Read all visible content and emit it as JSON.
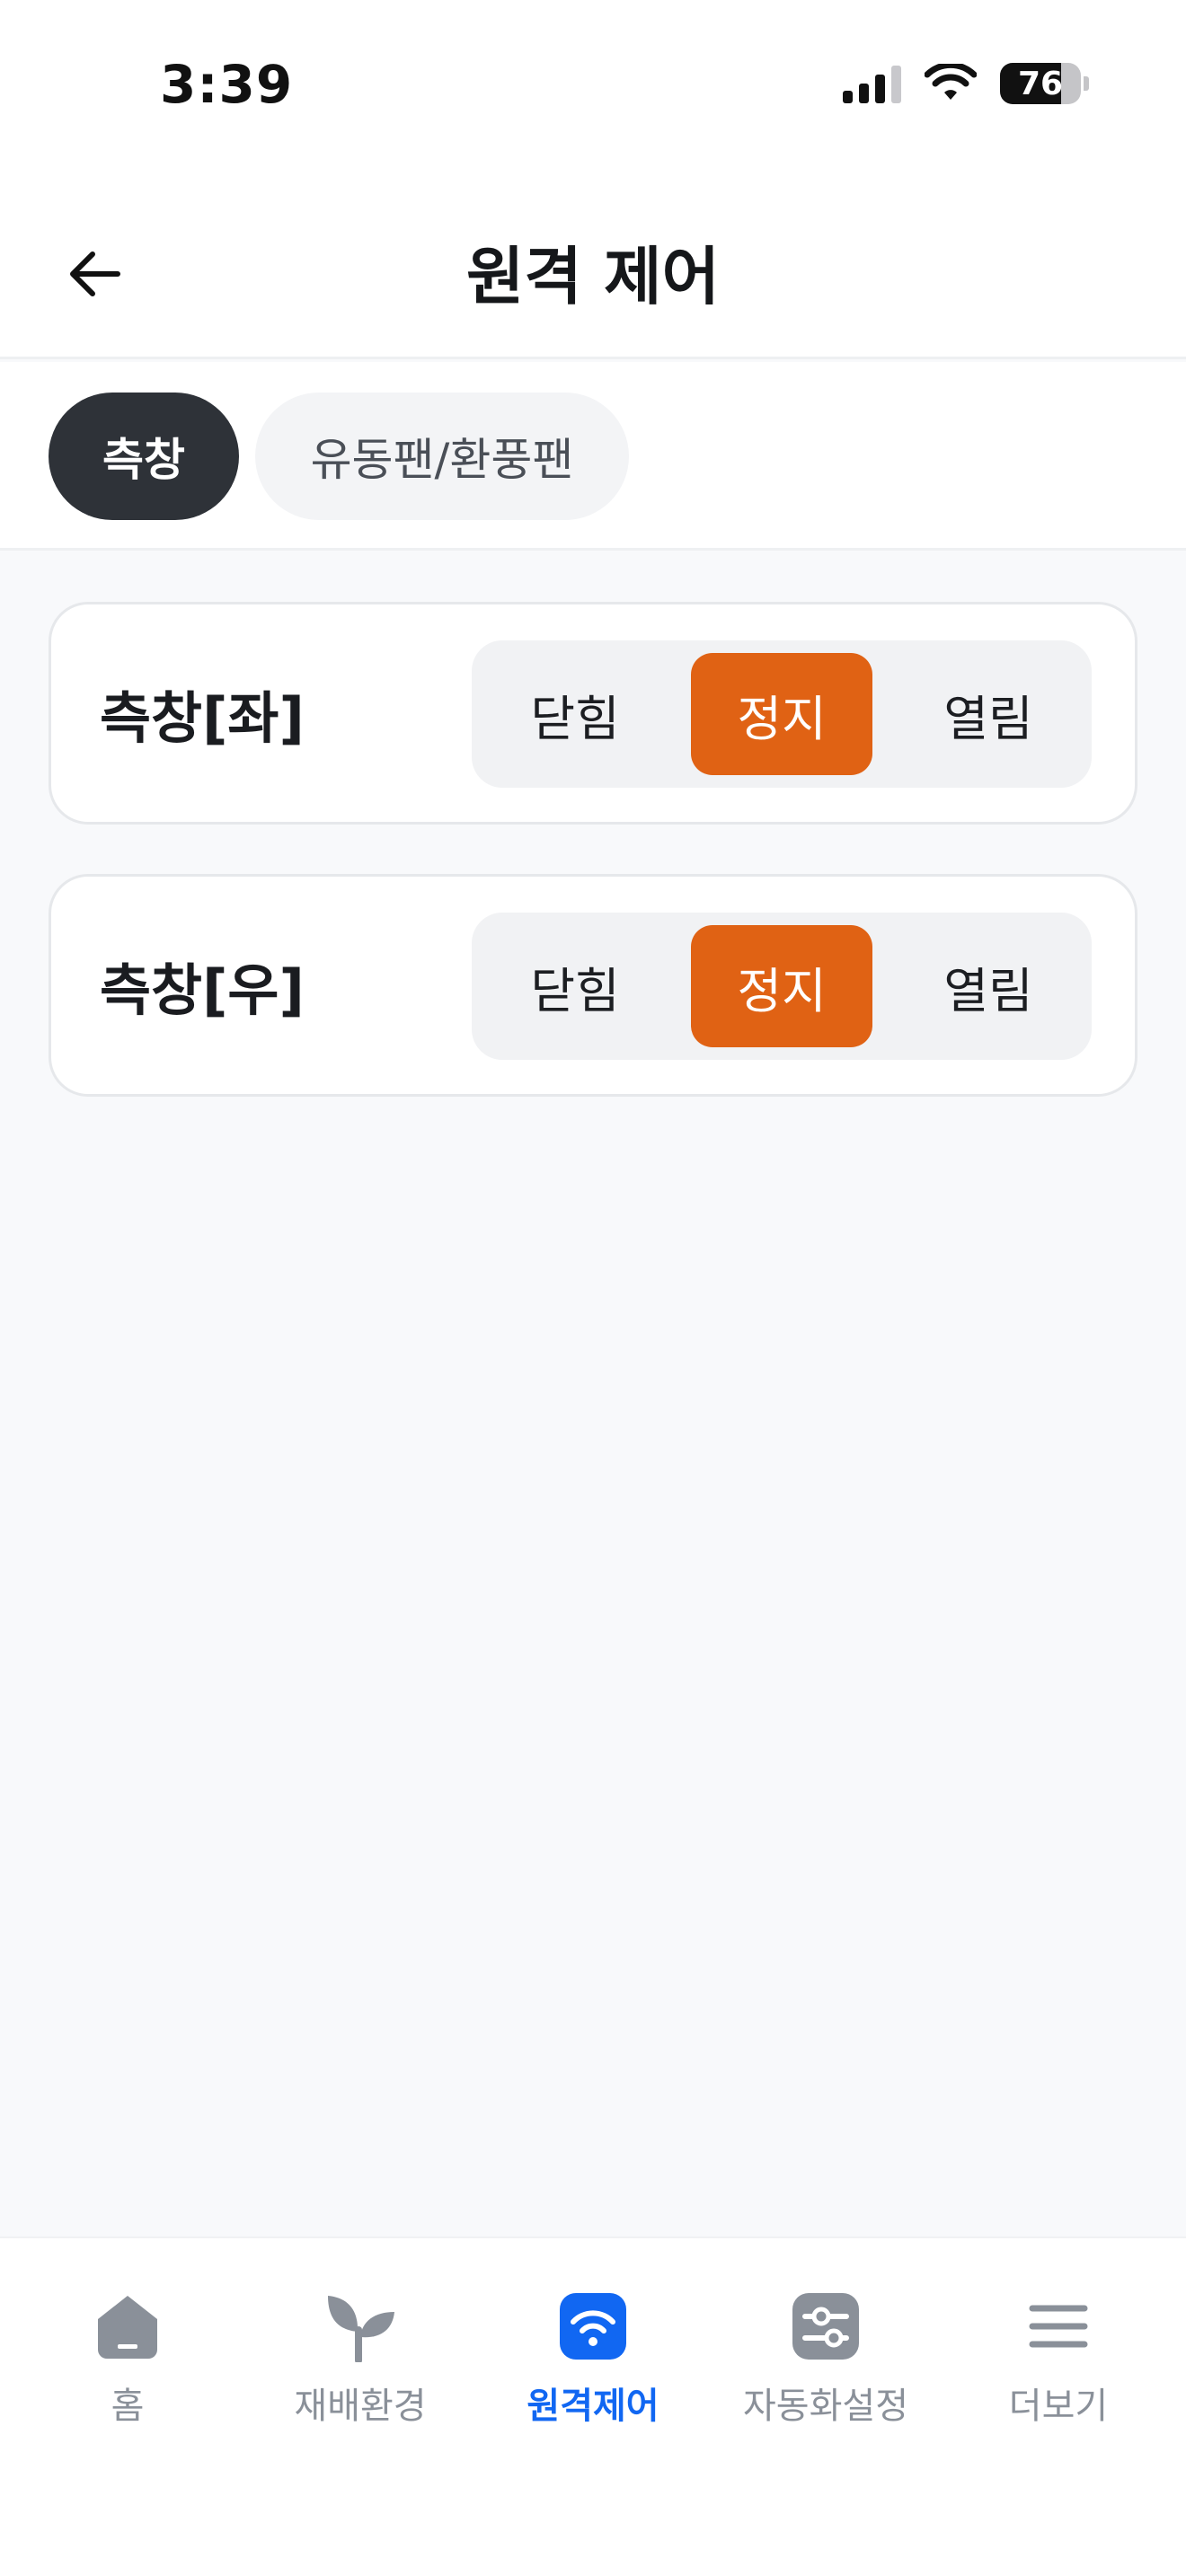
{
  "status_bar": {
    "time": "3:39",
    "battery": "76",
    "battery_level": 0.76
  },
  "header": {
    "title": "원격 제어",
    "back_icon": "arrow-left-icon"
  },
  "tabs": [
    {
      "label": "측창",
      "active": true
    },
    {
      "label": "유동팬/환풍팬",
      "active": false
    }
  ],
  "controls": [
    {
      "label": "측창[좌]",
      "options": [
        "닫힘",
        "정지",
        "열림"
      ],
      "selected": "정지"
    },
    {
      "label": "측창[우]",
      "options": [
        "닫힘",
        "정지",
        "열림"
      ],
      "selected": "정지"
    }
  ],
  "bottom_nav": [
    {
      "label": "홈",
      "icon": "home-icon",
      "active": false
    },
    {
      "label": "재배환경",
      "icon": "sprout-icon",
      "active": false
    },
    {
      "label": "원격제어",
      "icon": "wifi-icon",
      "active": true
    },
    {
      "label": "자동화설정",
      "icon": "sliders-icon",
      "active": false
    },
    {
      "label": "더보기",
      "icon": "menu-icon",
      "active": false
    }
  ],
  "colors": {
    "accent": "#E06214",
    "tab_active": "#2E3238",
    "nav_active": "#1167F2",
    "nav_inactive": "#8A9099"
  }
}
